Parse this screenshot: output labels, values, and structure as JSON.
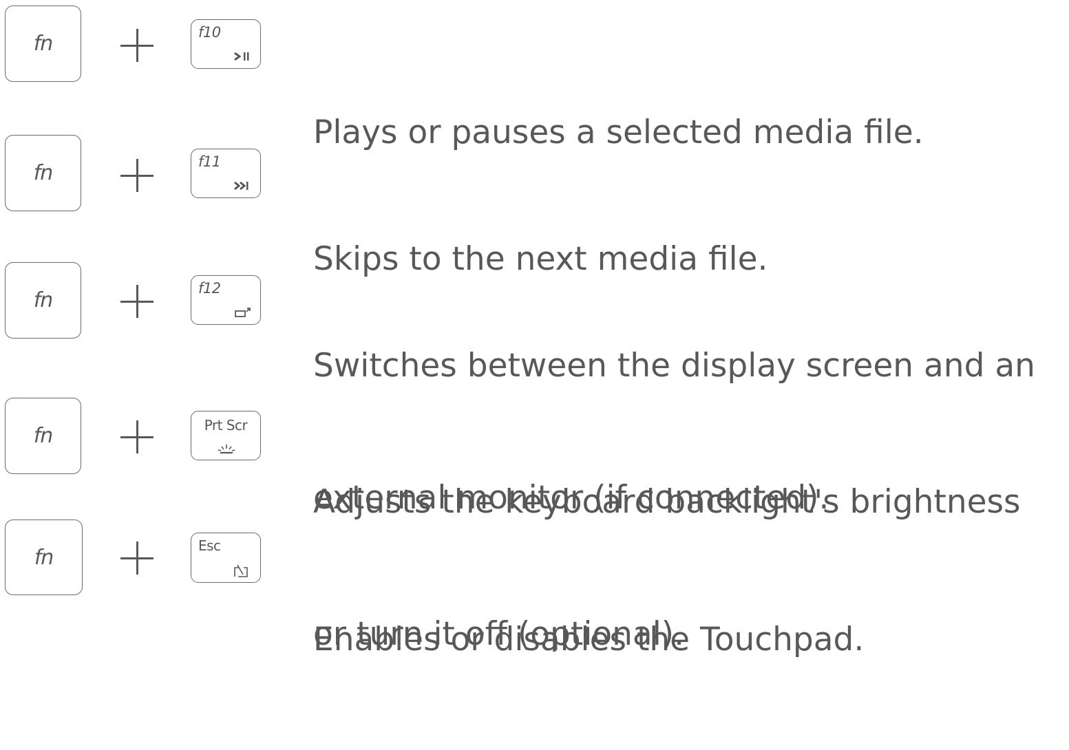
{
  "shortcuts": [
    {
      "modifier": "fn",
      "key_label": "f10",
      "key_icon": "play-pause-icon",
      "description": [
        "Plays or pauses a selected media file."
      ]
    },
    {
      "modifier": "fn",
      "key_label": "f11",
      "key_icon": "next-track-icon",
      "description": [
        "Skips to the next media file."
      ]
    },
    {
      "modifier": "fn",
      "key_label": "f12",
      "key_icon": "display-switch-icon",
      "description": [
        "Switches between the display screen and an",
        "external monitor (if connected)."
      ]
    },
    {
      "modifier": "fn",
      "key_label": "Prt Scr",
      "key_icon": "keyboard-backlight-icon",
      "description": [
        "Adjusts the keyboard backlight's brightness",
        "or turn it off (optional)."
      ]
    },
    {
      "modifier": "fn",
      "key_label": "Esc",
      "key_icon": "touchpad-toggle-icon",
      "description": [
        "Enables or disables the Touchpad."
      ]
    }
  ],
  "colors": {
    "text": "#58585a",
    "key_border": "#6b6b6d",
    "background": "#ffffff"
  }
}
